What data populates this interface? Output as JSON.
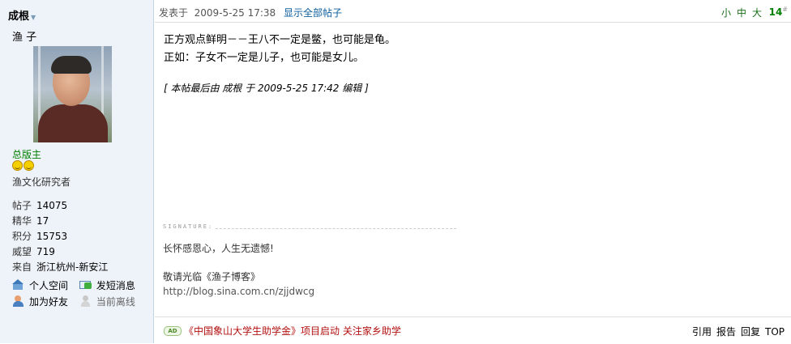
{
  "user": {
    "name": "成根",
    "nickname": "渔 子",
    "group": "总版主",
    "custom_title": "渔文化研究者",
    "stats": [
      {
        "label": "帖子",
        "value": "14075"
      },
      {
        "label": "精华",
        "value": "17"
      },
      {
        "label": "积分",
        "value": "15753"
      },
      {
        "label": "威望",
        "value": "719"
      },
      {
        "label": "来自",
        "value": "浙江杭州-新安江"
      }
    ],
    "links": {
      "space": "个人空间",
      "pm": "发短消息",
      "add_friend": "加为好友",
      "status": "当前离线"
    }
  },
  "post": {
    "posted_prefix": "发表于",
    "posted_time": "2009-5-25 17:38",
    "show_all": "显示全部帖子",
    "font_sizes": [
      "小",
      "中",
      "大"
    ],
    "floor_number": "14",
    "floor_mark": "#",
    "content_lines": [
      "正方观点鲜明－－王八不一定是鳖，也可能是龟。",
      "正如：子女不一定是儿子，也可能是女儿。"
    ],
    "edited_note": "[ 本帖最后由  成根  于  2009-5-25 17:42  编辑  ]"
  },
  "signature": {
    "label": "SIGNATURE:",
    "line1": "长怀感恩心，人生无遗憾!",
    "line2": "敬请光临《渔子博客》",
    "line3": "http://blog.sina.com.cn/zjjdwcg"
  },
  "footer": {
    "ad_badge": "AD",
    "ad_text": "《中国象山大学生助学金》项目启动  关注家乡助学",
    "actions": [
      "引用",
      "报告",
      "回复",
      "TOP"
    ]
  }
}
